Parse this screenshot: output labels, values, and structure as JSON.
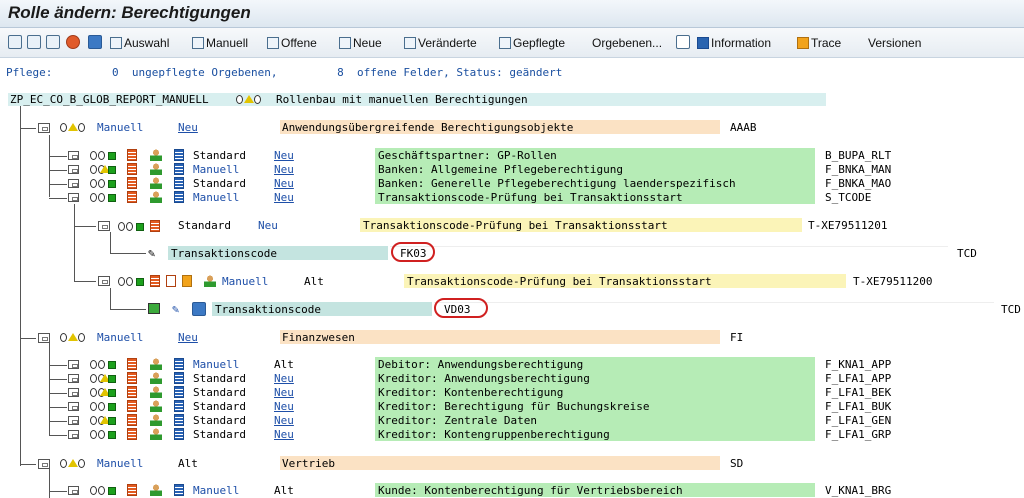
{
  "title": "Rolle ändern: Berechtigungen",
  "toolbar": {
    "auswahl": "Auswahl",
    "manuell": "Manuell",
    "offene": "Offene",
    "neue": "Neue",
    "veraenderte": "Veränderte",
    "gepflegte": "Gepflegte",
    "orgebenen": "Orgebenen...",
    "information": "Information",
    "trace": "Trace",
    "versionen": "Versionen"
  },
  "status": {
    "pflege_label": "Pflege:",
    "unmaintained_count": "0",
    "unmaintained_text": "ungepflegte Orgebenen,",
    "open_count": "8",
    "open_text": "offene Felder, Status: geändert"
  },
  "root": {
    "name": "ZP_EC_CO_B_GLOB_REPORT_MANUELL",
    "desc": "Rollenbau mit manuellen Berechtigungen"
  },
  "groups": [
    {
      "type": "Manuell",
      "status": "Neu",
      "desc": "Anwendungsübergreifende Berechtigungsobjekte",
      "code": "AAAB"
    },
    {
      "type": "Manuell",
      "status": "Neu",
      "desc": "Finanzwesen",
      "code": "FI"
    },
    {
      "type": "Manuell",
      "status": "Alt",
      "desc": "Vertrieb",
      "code": "SD"
    }
  ],
  "objects_aaab": [
    {
      "type": "Standard",
      "status": "Neu",
      "desc": "Geschäftspartner: GP-Rollen",
      "code": "B_BUPA_RLT"
    },
    {
      "type": "Manuell",
      "status": "Neu",
      "desc": "Banken: Allgemeine Pflegeberechtigung",
      "code": "F_BNKA_MAN"
    },
    {
      "type": "Standard",
      "status": "Neu",
      "desc": "Banken: Generelle Pflegeberechtigung laenderspezifisch",
      "code": "F_BNKA_MAO"
    },
    {
      "type": "Manuell",
      "status": "Neu",
      "desc": "Transaktionscode-Prüfung bei Transaktionsstart",
      "code": "S_TCODE"
    }
  ],
  "auth1": {
    "type": "Standard",
    "status": "Neu",
    "desc": "Transaktionscode-Prüfung bei Transaktionsstart",
    "code": "T-XE79511201",
    "field": "Transaktionscode",
    "value": "FK03",
    "fieldcode": "TCD"
  },
  "auth2": {
    "type": "Manuell",
    "status": "Alt",
    "desc": "Transaktionscode-Prüfung bei Transaktionsstart",
    "code": "T-XE79511200",
    "field": "Transaktionscode",
    "value": "VD03",
    "fieldcode": "TCD"
  },
  "objects_fi": [
    {
      "type": "Manuell",
      "status": "Alt",
      "desc": "Debitor: Anwendungsberechtigung",
      "code": "F_KNA1_APP"
    },
    {
      "type": "Standard",
      "status": "Neu",
      "desc": "Kreditor: Anwendungsberechtigung",
      "code": "F_LFA1_APP"
    },
    {
      "type": "Standard",
      "status": "Neu",
      "desc": "Kreditor: Kontenberechtigung",
      "code": "F_LFA1_BEK"
    },
    {
      "type": "Standard",
      "status": "Neu",
      "desc": "Kreditor: Berechtigung für Buchungskreise",
      "code": "F_LFA1_BUK"
    },
    {
      "type": "Standard",
      "status": "Neu",
      "desc": "Kreditor: Zentrale Daten",
      "code": "F_LFA1_GEN"
    },
    {
      "type": "Standard",
      "status": "Neu",
      "desc": "Kreditor: Kontengruppenberechtigung",
      "code": "F_LFA1_GRP"
    }
  ],
  "objects_sd": [
    {
      "type": "Manuell",
      "status": "Alt",
      "desc": "Kunde: Kontenberechtigung für Vertriebsbereich",
      "code": "V_KNA1_BRG"
    }
  ]
}
